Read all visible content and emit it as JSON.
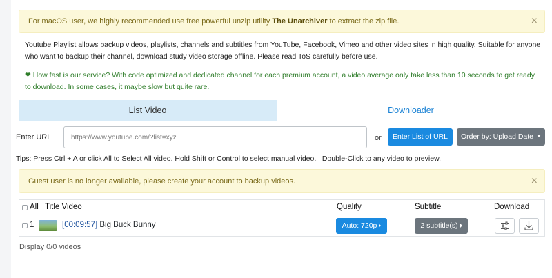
{
  "mac_alert": {
    "prefix": "For macOS user, we highly recommended use free powerful unzip utility ",
    "link": "The Unarchiver",
    "suffix": " to extract the zip file.",
    "close": "×"
  },
  "description": "Youtube Playlist allows backup videos, playlists, channels and subtitles from YouTube, Facebook, Vimeo and other video sites in high quality. Suitable for anyone who want to backup their channel, download study video storage offline. Please read ToS carefully before use.",
  "speed_note": {
    "heart": "❤",
    "text": " How fast is our service? With code optimized and dedicated channel for each premium account, a video average only take less than 10 seconds to get ready to download. In some cases, it maybe slow but quite rare."
  },
  "tabs": [
    {
      "label": "List Video",
      "active": true
    },
    {
      "label": "Downloader",
      "active": false
    }
  ],
  "url_form": {
    "label": "Enter URL",
    "placeholder": "https://www.youtube.com/?list=xyz",
    "or": "or",
    "enter_button": "Enter List of URL",
    "order_button": "Order by: Upload Date"
  },
  "tips": "Tips: Press Ctrl + A or click All to Select All video. Hold Shift or Control to select manual video. | Double-Click to any video to preview.",
  "guest_alert": {
    "text": "Guest user is no longer available, please create your account to backup videos.",
    "close": "×"
  },
  "table": {
    "headers": {
      "all": "All",
      "title": "Title Video",
      "quality": "Quality",
      "subtitle": "Subtitle",
      "download": "Download"
    },
    "rows": [
      {
        "index": "1",
        "duration": "[00:09:57]",
        "title": "Big Buck Bunny",
        "quality": "Auto: 720p",
        "subtitle": "2 subtitle(s)"
      }
    ]
  },
  "display_count": "Display 0/0 videos",
  "colors": {
    "primary": "#1a8ae0",
    "secondary": "#6c757d",
    "alert_bg": "#fcf8da",
    "success_text": "#2f7d2a",
    "active_tab": "#d7ebf8"
  },
  "icons": {
    "row_settings": "sliders-icon",
    "row_download": "download-icon"
  }
}
